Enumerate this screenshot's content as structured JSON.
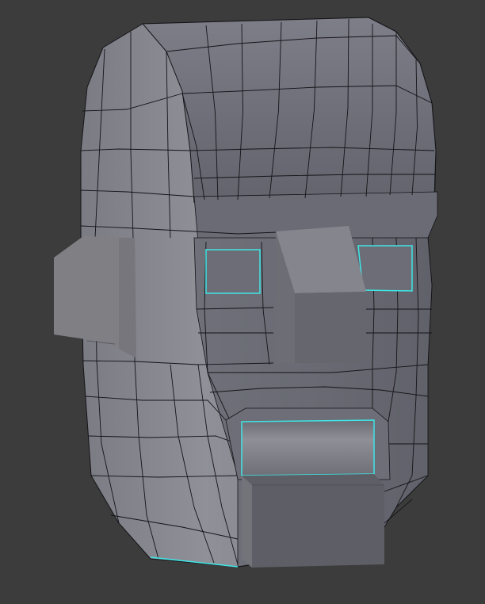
{
  "viewport": {
    "background": "#3c3c3c",
    "object_type": "low-poly head mesh",
    "mode": "edit",
    "colors": {
      "face_light": "#8d8e97",
      "face_mid": "#787982",
      "face_dark": "#5f6069",
      "wire": "#141418",
      "selected_edge": "#3ee6e6",
      "nose_top": "#85858d",
      "nose_front": "#6a6a72",
      "ear": "#7f7f84",
      "mouth_block": "#5e5f66"
    }
  }
}
